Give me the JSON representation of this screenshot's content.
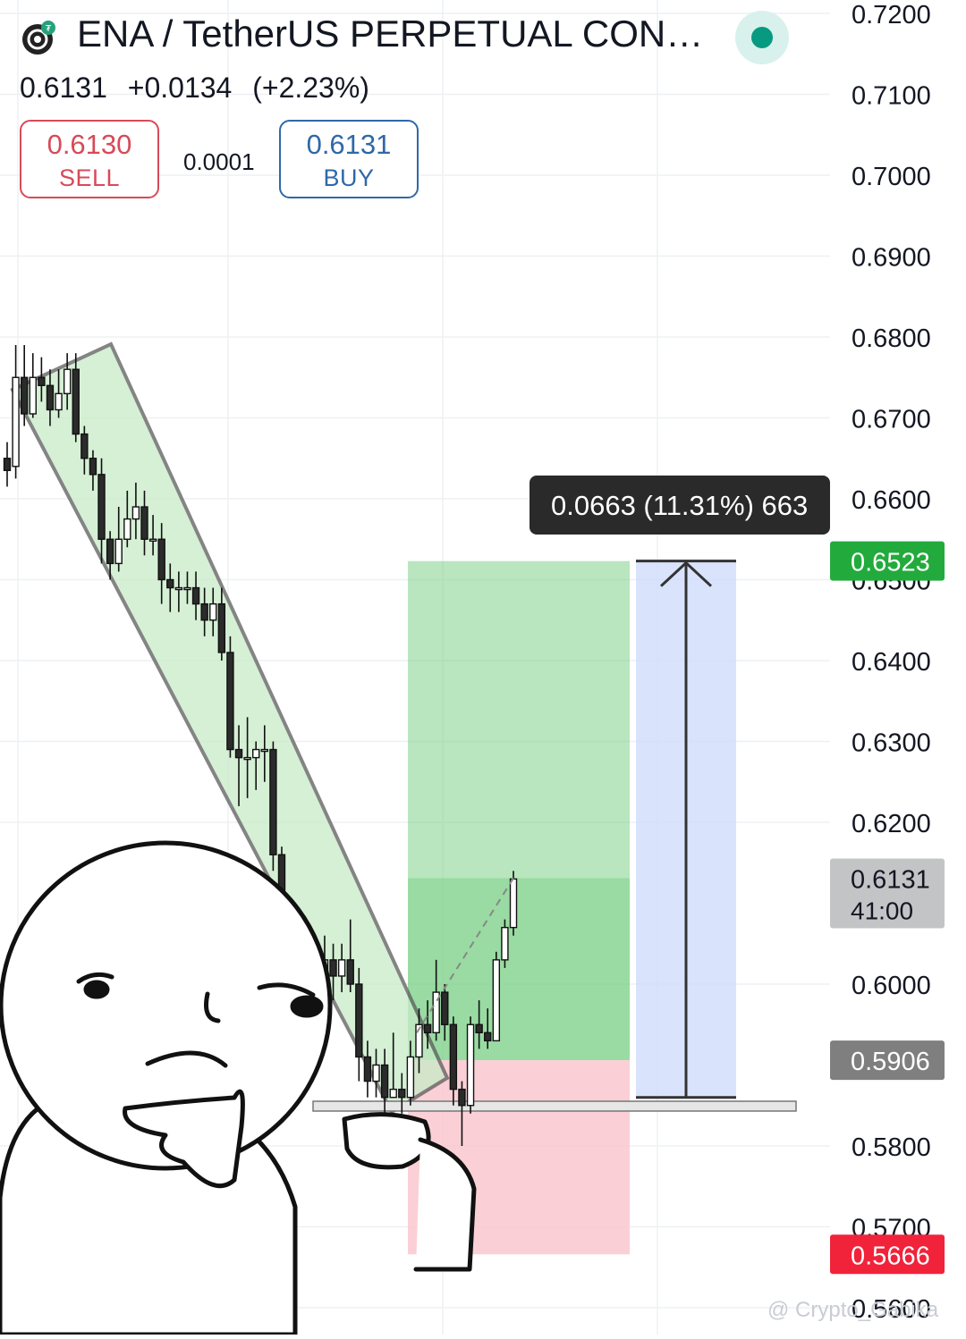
{
  "header": {
    "title": "ENA / TetherUS PERPETUAL CON…",
    "last_price": "0.6131",
    "change": "+0.0134",
    "change_pct": "(+2.23%)",
    "sell": {
      "price": "0.6130",
      "label": "SELL"
    },
    "buy": {
      "price": "0.6131",
      "label": "BUY"
    },
    "spread": "0.0001"
  },
  "colors": {
    "up": "#089981",
    "down": "#f23645",
    "sell_border": "#d84a58",
    "buy_border": "#2f68a8",
    "channel_fill": "#c8ebc8",
    "target_zone": "#7fd18a",
    "stop_zone": "#f9c4cc",
    "measure_zone": "#cfdcfb"
  },
  "watermark": "@ Crypto_Gabika",
  "chart_data": {
    "type": "candlestick",
    "y_axis": {
      "ticks": [
        "0.7200",
        "0.7100",
        "0.7000",
        "0.6900",
        "0.6800",
        "0.6700",
        "0.6600",
        "0.6500",
        "0.6400",
        "0.6300",
        "0.6200",
        "0.6000",
        "0.5800",
        "0.5700",
        "0.5600"
      ],
      "range": [
        0.56,
        0.72
      ]
    },
    "price_labels": [
      {
        "value": 0.6523,
        "text": "0.6523",
        "color": "#22ab3c"
      },
      {
        "value": 0.6131,
        "text": "0.6131",
        "sub": "41:00",
        "color": "#c3c4c6"
      },
      {
        "value": 0.5906,
        "text": "0.5906",
        "color": "#7f7f7f"
      },
      {
        "value": 0.5666,
        "text": "0.5666",
        "color": "#f0233b"
      }
    ],
    "measurement": {
      "text": "0.0663 (11.31%) 663",
      "from": 0.586,
      "to": 0.6523
    },
    "position": {
      "entry": 0.5906,
      "target": 0.6523,
      "stop": 0.5666
    },
    "channel": "descending",
    "candles": [
      [
        0.665,
        0.6635,
        0.667,
        0.6615
      ],
      [
        0.664,
        0.675,
        0.679,
        0.6625
      ],
      [
        0.675,
        0.6705,
        0.679,
        0.669
      ],
      [
        0.6705,
        0.675,
        0.678,
        0.67
      ],
      [
        0.675,
        0.674,
        0.6775,
        0.672
      ],
      [
        0.674,
        0.671,
        0.676,
        0.669
      ],
      [
        0.671,
        0.673,
        0.676,
        0.67
      ],
      [
        0.673,
        0.676,
        0.678,
        0.671
      ],
      [
        0.676,
        0.668,
        0.678,
        0.667
      ],
      [
        0.668,
        0.665,
        0.669,
        0.663
      ],
      [
        0.665,
        0.663,
        0.666,
        0.661
      ],
      [
        0.663,
        0.655,
        0.665,
        0.652
      ],
      [
        0.655,
        0.652,
        0.656,
        0.65
      ],
      [
        0.652,
        0.655,
        0.659,
        0.651
      ],
      [
        0.655,
        0.6575,
        0.661,
        0.654
      ],
      [
        0.6575,
        0.659,
        0.662,
        0.655
      ],
      [
        0.659,
        0.655,
        0.661,
        0.653
      ],
      [
        0.655,
        0.655,
        0.658,
        0.653
      ],
      [
        0.655,
        0.65,
        0.657,
        0.647
      ],
      [
        0.65,
        0.649,
        0.652,
        0.646
      ],
      [
        0.649,
        0.649,
        0.651,
        0.646
      ],
      [
        0.649,
        0.649,
        0.651,
        0.647
      ],
      [
        0.649,
        0.647,
        0.651,
        0.645
      ],
      [
        0.647,
        0.645,
        0.649,
        0.643
      ],
      [
        0.645,
        0.647,
        0.649,
        0.643
      ],
      [
        0.647,
        0.641,
        0.649,
        0.64
      ],
      [
        0.641,
        0.629,
        0.643,
        0.628
      ],
      [
        0.629,
        0.628,
        0.632,
        0.622
      ],
      [
        0.628,
        0.628,
        0.633,
        0.623
      ],
      [
        0.628,
        0.629,
        0.63,
        0.624
      ],
      [
        0.629,
        0.629,
        0.632,
        0.625
      ],
      [
        0.629,
        0.616,
        0.63,
        0.614
      ],
      [
        0.616,
        0.608,
        0.617,
        0.605
      ],
      [
        0.608,
        0.606,
        0.609,
        0.603
      ],
      [
        0.606,
        0.604,
        0.608,
        0.602
      ],
      [
        0.604,
        0.602,
        0.606,
        0.599
      ],
      [
        0.602,
        0.6,
        0.604,
        0.598
      ],
      [
        0.6,
        0.603,
        0.606,
        0.599
      ],
      [
        0.603,
        0.601,
        0.605,
        0.598
      ],
      [
        0.601,
        0.603,
        0.605,
        0.599
      ],
      [
        0.603,
        0.6,
        0.608,
        0.599
      ],
      [
        0.6,
        0.591,
        0.602,
        0.588
      ],
      [
        0.591,
        0.588,
        0.593,
        0.586
      ],
      [
        0.588,
        0.59,
        0.592,
        0.586
      ],
      [
        0.59,
        0.586,
        0.592,
        0.584
      ],
      [
        0.586,
        0.587,
        0.594,
        0.586
      ],
      [
        0.587,
        0.586,
        0.589,
        0.584
      ],
      [
        0.586,
        0.591,
        0.593,
        0.585
      ],
      [
        0.591,
        0.595,
        0.597,
        0.589
      ],
      [
        0.595,
        0.594,
        0.598,
        0.592
      ],
      [
        0.594,
        0.599,
        0.603,
        0.593
      ],
      [
        0.599,
        0.595,
        0.6,
        0.593
      ],
      [
        0.595,
        0.587,
        0.596,
        0.585
      ],
      [
        0.587,
        0.585,
        0.588,
        0.58
      ],
      [
        0.585,
        0.595,
        0.596,
        0.584
      ],
      [
        0.595,
        0.594,
        0.598,
        0.592
      ],
      [
        0.594,
        0.593,
        0.597,
        0.592
      ],
      [
        0.593,
        0.603,
        0.604,
        0.593
      ],
      [
        0.603,
        0.607,
        0.608,
        0.602
      ],
      [
        0.607,
        0.613,
        0.614,
        0.606
      ]
    ]
  }
}
